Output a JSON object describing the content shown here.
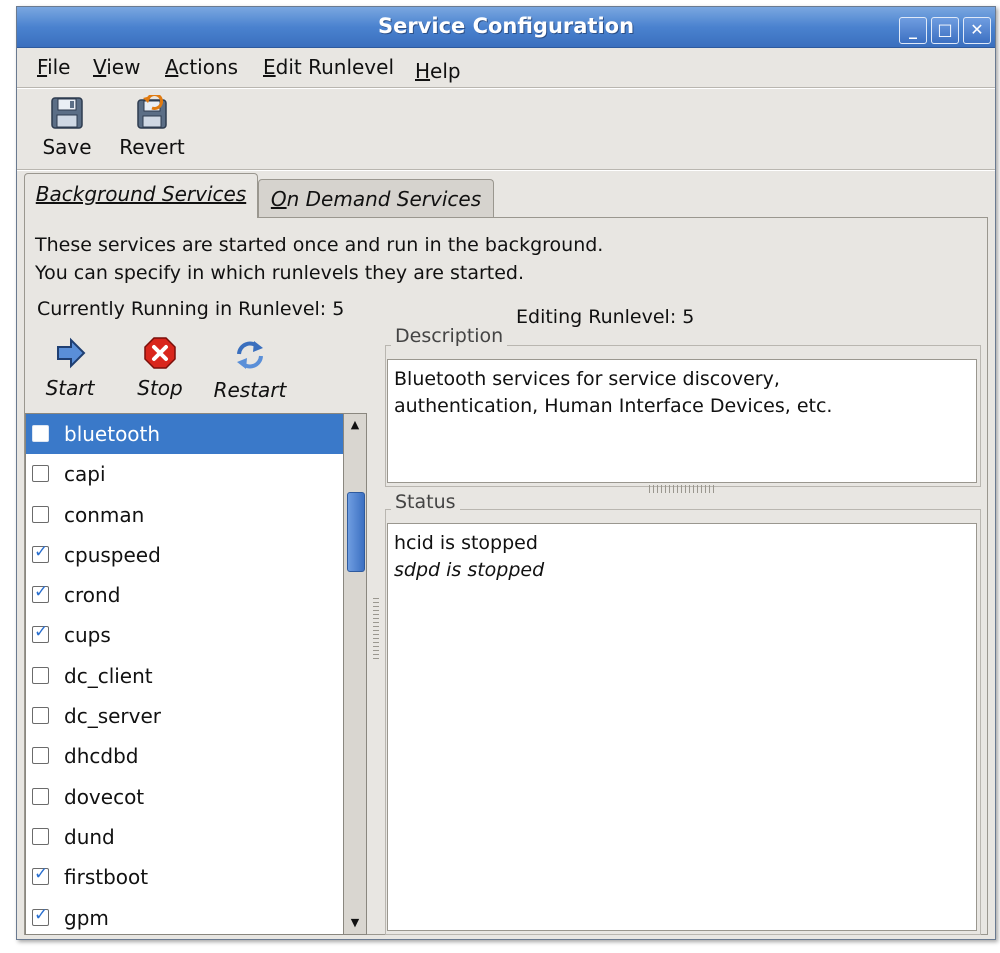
{
  "window": {
    "title": "Service Configuration",
    "controls": {
      "minimize": "_",
      "maximize": "□",
      "close": "✕"
    }
  },
  "menu": [
    {
      "mnemonic": "F",
      "rest": "ile"
    },
    {
      "mnemonic": "V",
      "rest": "iew"
    },
    {
      "mnemonic": "A",
      "rest": "ctions"
    },
    {
      "mnemonic": "E",
      "rest": "dit Runlevel"
    },
    {
      "mnemonic": "H",
      "rest": "elp"
    }
  ],
  "toolbar": {
    "save_label": "Save",
    "revert_label": "Revert",
    "save_icon": "floppy-disk-icon",
    "revert_icon": "revert-icon"
  },
  "tabs": {
    "background": "Background Services",
    "on_demand_prefix": "O",
    "on_demand_rest": "n Demand Services"
  },
  "panel": {
    "intro_line1": "These services are started once and run in the background.",
    "intro_line2": "You can specify in which runlevels they are started.",
    "currently_running": "Currently Running in Runlevel: 5",
    "editing_runlevel": "Editing Runlevel: 5"
  },
  "actions": {
    "start": "Start",
    "stop": "Stop",
    "restart": "Restart"
  },
  "services": [
    {
      "name": "bluetooth",
      "checked": false,
      "selected": true
    },
    {
      "name": "capi",
      "checked": false,
      "selected": false
    },
    {
      "name": "conman",
      "checked": false,
      "selected": false
    },
    {
      "name": "cpuspeed",
      "checked": true,
      "selected": false
    },
    {
      "name": "crond",
      "checked": true,
      "selected": false
    },
    {
      "name": "cups",
      "checked": true,
      "selected": false
    },
    {
      "name": "dc_client",
      "checked": false,
      "selected": false
    },
    {
      "name": "dc_server",
      "checked": false,
      "selected": false
    },
    {
      "name": "dhcdbd",
      "checked": false,
      "selected": false
    },
    {
      "name": "dovecot",
      "checked": false,
      "selected": false
    },
    {
      "name": "dund",
      "checked": false,
      "selected": false
    },
    {
      "name": "firstboot",
      "checked": true,
      "selected": false
    },
    {
      "name": "gpm",
      "checked": true,
      "selected": false
    }
  ],
  "description": {
    "label": "Description",
    "line1": "Bluetooth services for service discovery,",
    "line2": "authentication, Human Interface Devices, etc."
  },
  "status": {
    "label": "Status",
    "line1": "hcid is stopped",
    "line2": "sdpd is stopped"
  },
  "scrollbar": {
    "up_arrow": "▲",
    "down_arrow": "▼"
  },
  "colors": {
    "selection": "#3a79c9",
    "titlebar": "#4a82cf",
    "stop_red": "#d9261c",
    "check_blue": "#2a6fcf"
  }
}
